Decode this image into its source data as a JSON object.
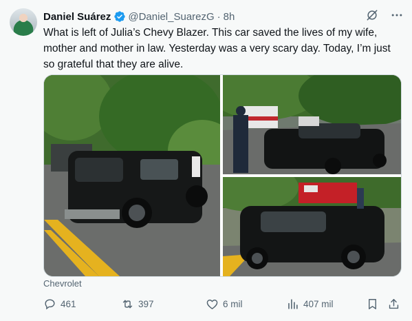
{
  "post": {
    "author_name": "Daniel Suárez",
    "handle": "@Daniel_SuarezG",
    "separator": "·",
    "time": "8h",
    "text": "What is left of Julia’s Chevy Blazer. This car saved the lives of my wife, mother and mother in law. Yesterday was a very scary day. Today, I’m just so grateful that they are alive.",
    "card_source": "Chevrolet",
    "icons": {
      "verified": "verified-badge-icon",
      "grok": "grok-icon",
      "more": "more-icon",
      "reply": "reply-icon",
      "repost": "repost-icon",
      "like": "heart-icon",
      "views": "views-chart-icon",
      "bookmark": "bookmark-icon",
      "share": "share-icon"
    }
  },
  "stats": {
    "replies": "461",
    "reposts": "397",
    "likes": "6 mil",
    "views": "407 mil"
  },
  "colors": {
    "text": "#0f1419",
    "secondary": "#536471",
    "verified": "#1d9bf0",
    "border": "#cfd9de",
    "background": "#f7f9f9"
  }
}
